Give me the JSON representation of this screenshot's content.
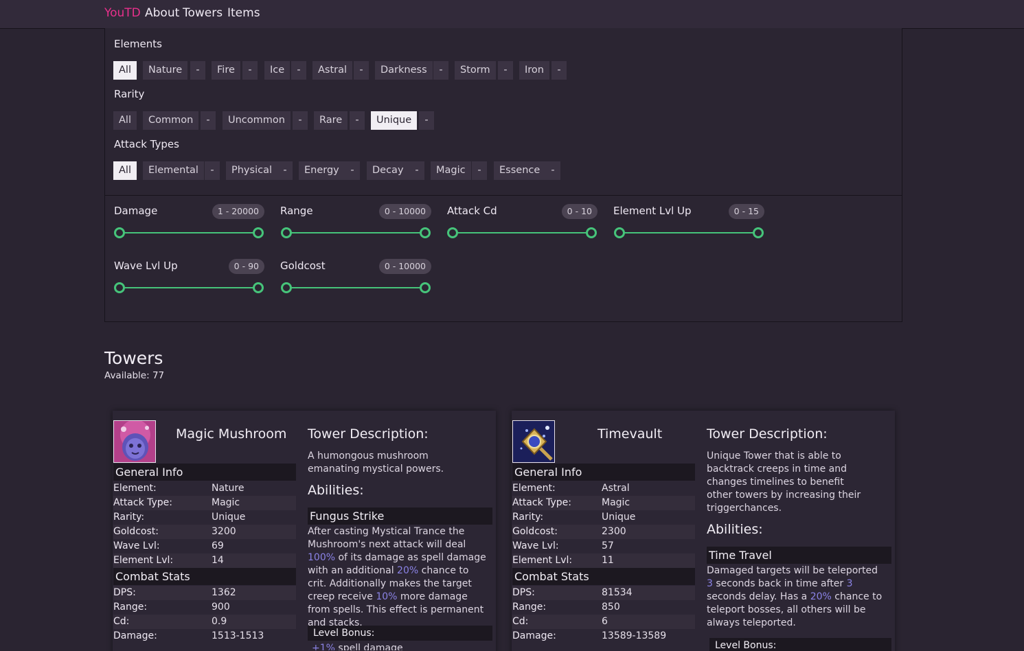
{
  "nav": {
    "brand": "YouTD",
    "links": [
      "About",
      "Towers",
      "Items"
    ]
  },
  "filters": {
    "elements_title": "Elements",
    "elements": [
      "All",
      "Nature",
      "Fire",
      "Ice",
      "Astral",
      "Darkness",
      "Storm",
      "Iron"
    ],
    "rarity_title": "Rarity",
    "rarity": [
      "All",
      "Common",
      "Uncommon",
      "Rare",
      "Unique"
    ],
    "attack_title": "Attack Types",
    "attack_types": [
      "All",
      "Elemental",
      "Physical",
      "Energy",
      "Decay",
      "Magic",
      "Essence"
    ],
    "minus": "-",
    "ranges": [
      {
        "label": "Damage",
        "value": "1 - 20000"
      },
      {
        "label": "Range",
        "value": "0 - 10000"
      },
      {
        "label": "Attack Cd",
        "value": "0 - 10"
      },
      {
        "label": "Element Lvl Up",
        "value": "0 - 15"
      },
      {
        "label": "Wave Lvl Up",
        "value": "0 - 90"
      },
      {
        "label": "Goldcost",
        "value": "0 - 10000"
      }
    ]
  },
  "towers_section": {
    "title": "Towers",
    "available": "Available: 77"
  },
  "colors": {
    "brand": "#e8308c",
    "slider": "#46c47a",
    "nature": "#5fd38a",
    "magic": "#d84bd6",
    "unique": "#9d5ef0",
    "astral": "#f0e06a",
    "highlight": "#8b83e6"
  },
  "towers": [
    {
      "name": "Magic Mushroom",
      "icon": "mushroom-icon",
      "general_title": "General Info",
      "combat_title": "Combat Stats",
      "labels": {
        "element": "Element:",
        "attack": "Attack Type:",
        "rarity": "Rarity:",
        "gold": "Goldcost:",
        "wave": "Wave Lvl:",
        "elvl": "Element Lvl:",
        "dps": "DPS:",
        "range": "Range:",
        "cd": "Cd:",
        "damage": "Damage:"
      },
      "element": "Nature",
      "attack_type": "Magic",
      "rarity": "Unique",
      "goldcost": "3200",
      "wave_lvl": "69",
      "element_lvl": "14",
      "dps": "1362",
      "range": "900",
      "cd": "0.9",
      "damage": "1513-1513",
      "desc_title": "Tower Description:",
      "description": "A humongous mushroom emanating mystical powers.",
      "abilities_title": "Abilities:",
      "ability_name": "Fungus Strike",
      "ability_text_1": "After casting Mystical Trance the Mushroom's next attack will deal ",
      "ability_hl_1": "100%",
      "ability_text_2": " of its damage as spell damage with an additional ",
      "ability_hl_2": "20%",
      "ability_text_3": " chance to crit. Additionally makes the target creep receive ",
      "ability_hl_3": "10%",
      "ability_text_4": " more damage from spells. This effect is permanent and stacks.",
      "level_bonus_title": "Level Bonus:",
      "level_bonus_hl": "+1%",
      "level_bonus_text": " spell damage"
    },
    {
      "name": "Timevault",
      "icon": "timevault-icon",
      "general_title": "General Info",
      "combat_title": "Combat Stats",
      "labels": {
        "element": "Element:",
        "attack": "Attack Type:",
        "rarity": "Rarity:",
        "gold": "Goldcost:",
        "wave": "Wave Lvl:",
        "elvl": "Element Lvl:",
        "dps": "DPS:",
        "range": "Range:",
        "cd": "Cd:",
        "damage": "Damage:"
      },
      "element": "Astral",
      "attack_type": "Magic",
      "rarity": "Unique",
      "goldcost": "2300",
      "wave_lvl": "57",
      "element_lvl": "11",
      "dps": "81534",
      "range": "850",
      "cd": "6",
      "damage": "13589-13589",
      "desc_title": "Tower Description:",
      "description": "Unique Tower that is able to backtrack creeps in time and changes timelines to benefit other towers by increasing their triggerchances.",
      "abilities_title": "Abilities:",
      "ability_name": "Time Travel",
      "ability_text_1": "Damaged targets will be teleported ",
      "ability_hl_1": "3",
      "ability_text_2": " seconds back in time after ",
      "ability_hl_2": "3",
      "ability_text_3": " seconds delay. Has a ",
      "ability_hl_3": "20%",
      "ability_text_4": " chance to teleport bosses, all others will be always teleported.",
      "level_bonus_title": "Level Bonus:"
    }
  ]
}
